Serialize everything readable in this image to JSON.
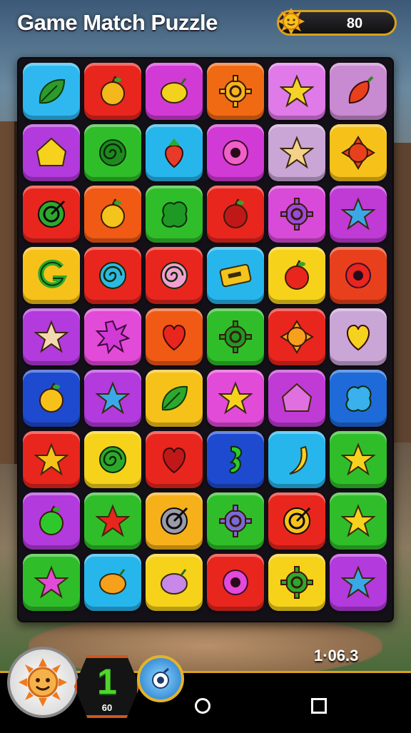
{
  "header": {
    "title": "Game Match Puzzle",
    "score": "80",
    "score_icon": "sun-icon"
  },
  "board": {
    "rows": 9,
    "cols": 6,
    "tiles": [
      [
        {
          "bg": "#2fb8f0",
          "icon": "leaf",
          "fg": "#2e9a2c"
        },
        {
          "bg": "#e8261e",
          "icon": "apple",
          "fg": "#f2b81c"
        },
        {
          "bg": "#d23ad6",
          "icon": "lemon",
          "fg": "#f3d21e"
        },
        {
          "bg": "#f06a14",
          "icon": "gear",
          "fg": "#f6b41e"
        },
        {
          "bg": "#e07ae8",
          "icon": "star",
          "fg": "#f4d22a"
        },
        {
          "bg": "#c88ad0",
          "icon": "chili",
          "fg": "#e8401c"
        }
      ],
      [
        {
          "bg": "#b33adc",
          "icon": "house",
          "fg": "#f6d21e"
        },
        {
          "bg": "#2fbe2a",
          "icon": "swirl",
          "fg": "#1e8a1e"
        },
        {
          "bg": "#26b6ec",
          "icon": "strawberry",
          "fg": "#e83a28"
        },
        {
          "bg": "#d23ad6",
          "icon": "ring",
          "fg": "#f060c8"
        },
        {
          "bg": "#c9a6d6",
          "icon": "star",
          "fg": "#f4d28a"
        },
        {
          "bg": "#f6c21a",
          "icon": "sun",
          "fg": "#e8401c"
        }
      ],
      [
        {
          "bg": "#e8261e",
          "icon": "target",
          "fg": "#2ea82c"
        },
        {
          "bg": "#f05a14",
          "icon": "apple",
          "fg": "#f2c41c"
        },
        {
          "bg": "#2fbe2a",
          "icon": "blob",
          "fg": "#1e9a24"
        },
        {
          "bg": "#e8261e",
          "icon": "apple",
          "fg": "#c01818"
        },
        {
          "bg": "#d84ad8",
          "icon": "gear",
          "fg": "#9a4ad8"
        },
        {
          "bg": "#c03ad6",
          "icon": "star",
          "fg": "#3aa8e8"
        }
      ],
      [
        {
          "bg": "#f6c21a",
          "icon": "letter-g",
          "fg": "#2ea82c"
        },
        {
          "bg": "#e8261e",
          "icon": "swirl",
          "fg": "#2eb8e0"
        },
        {
          "bg": "#e8261e",
          "icon": "swirl",
          "fg": "#f2a0d0"
        },
        {
          "bg": "#26b6ec",
          "icon": "ticket",
          "fg": "#f2c41c"
        },
        {
          "bg": "#f6d21a",
          "icon": "apple",
          "fg": "#e8261e"
        },
        {
          "bg": "#e8401c",
          "icon": "ring",
          "fg": "#e8261e"
        }
      ],
      [
        {
          "bg": "#b33adc",
          "icon": "star",
          "fg": "#f4d8b0"
        },
        {
          "bg": "#e24ad8",
          "icon": "splat",
          "fg": "#d23ad6"
        },
        {
          "bg": "#f05a14",
          "icon": "heart",
          "fg": "#e8261e"
        },
        {
          "bg": "#2fbe2a",
          "icon": "gear",
          "fg": "#1e9a24"
        },
        {
          "bg": "#e8261e",
          "icon": "sun",
          "fg": "#f6a01c"
        },
        {
          "bg": "#c9a6d6",
          "icon": "heart",
          "fg": "#f4d21e"
        }
      ],
      [
        {
          "bg": "#1e4ad0",
          "icon": "apple",
          "fg": "#f6c21a"
        },
        {
          "bg": "#b33adc",
          "icon": "star",
          "fg": "#3aa8e8"
        },
        {
          "bg": "#f6c21a",
          "icon": "leaf",
          "fg": "#2ea82c"
        },
        {
          "bg": "#e24ad8",
          "icon": "star",
          "fg": "#f6d21e"
        },
        {
          "bg": "#c03ad6",
          "icon": "house",
          "fg": "#e070e0"
        },
        {
          "bg": "#1e6ad8",
          "icon": "blob",
          "fg": "#3ab0ec"
        }
      ],
      [
        {
          "bg": "#e8261e",
          "icon": "star",
          "fg": "#f6c21a"
        },
        {
          "bg": "#f6d21a",
          "icon": "swirl",
          "fg": "#2ea82c"
        },
        {
          "bg": "#e8261e",
          "icon": "heart",
          "fg": "#c01818"
        },
        {
          "bg": "#1e4ad0",
          "icon": "seahorse",
          "fg": "#2ec82c"
        },
        {
          "bg": "#26b6ec",
          "icon": "banana",
          "fg": "#f6d21e"
        },
        {
          "bg": "#2fbe2a",
          "icon": "star",
          "fg": "#f6d21e"
        }
      ],
      [
        {
          "bg": "#b33adc",
          "icon": "apple",
          "fg": "#2ec82c"
        },
        {
          "bg": "#2fbe2a",
          "icon": "star",
          "fg": "#e8261e"
        },
        {
          "bg": "#f6b01a",
          "icon": "target",
          "fg": "#9a9aa8"
        },
        {
          "bg": "#2fbe2a",
          "icon": "gear",
          "fg": "#7a6ad8"
        },
        {
          "bg": "#e8261e",
          "icon": "target",
          "fg": "#f6c21a"
        },
        {
          "bg": "#2fbe2a",
          "icon": "star",
          "fg": "#f6d21e"
        }
      ],
      [
        {
          "bg": "#2fbe2a",
          "icon": "star",
          "fg": "#e24ad8"
        },
        {
          "bg": "#26b6ec",
          "icon": "lemon",
          "fg": "#f6a01c"
        },
        {
          "bg": "#f6d21a",
          "icon": "lemon",
          "fg": "#c888e8"
        },
        {
          "bg": "#e8261e",
          "icon": "ring",
          "fg": "#e24ad8"
        },
        {
          "bg": "#f6d21a",
          "icon": "gear",
          "fg": "#2ea82c"
        },
        {
          "bg": "#b33adc",
          "icon": "star",
          "fg": "#3aa8e8"
        }
      ]
    ]
  },
  "footer": {
    "timer": "1·06.3",
    "level": "1",
    "level_sub": "60",
    "avatar_icon": "sun-face-icon",
    "powerup_icon": "bomb-icon"
  }
}
